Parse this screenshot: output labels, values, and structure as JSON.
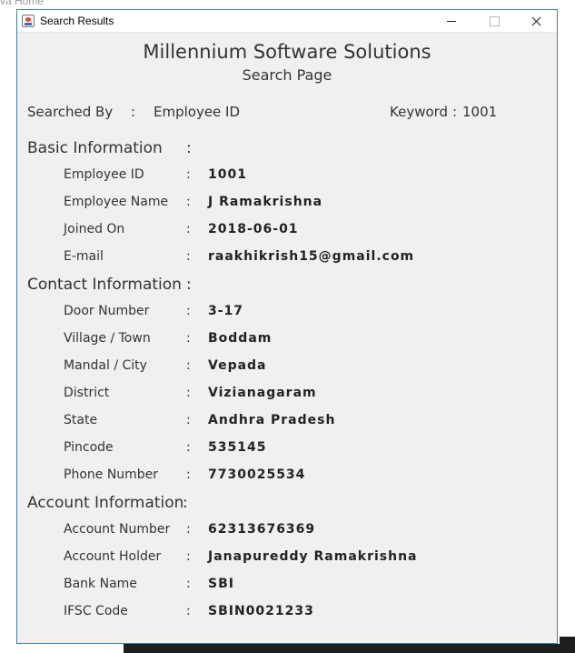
{
  "background": {
    "behind_text": "va Home"
  },
  "window": {
    "title": "Search Results"
  },
  "header": {
    "company": "Millennium Software Solutions",
    "subtitle": "Search Page"
  },
  "search": {
    "by_label": "Searched By",
    "colon": ":",
    "by_value": "Employee ID",
    "keyword_label": "Keyword",
    "keyword_colon": ":",
    "keyword_value": "1001"
  },
  "sections": {
    "basic": {
      "title": "Basic Information",
      "colon": ":",
      "fields": [
        {
          "label": "Employee  ID",
          "colon": ":",
          "value": "1001"
        },
        {
          "label": "Employee  Name",
          "colon": ":",
          "value": "J Ramakrishna"
        },
        {
          "label": "Joined  On",
          "colon": ":",
          "value": "2018-06-01"
        },
        {
          "label": "E-mail",
          "colon": ":",
          "value": "raakhikrish15@gmail.com"
        }
      ]
    },
    "contact": {
      "title": "Contact Information",
      "colon": ":",
      "fields": [
        {
          "label": "Door Number",
          "colon": ":",
          "value": "3-17"
        },
        {
          "label": "Village / Town",
          "colon": ":",
          "value": "Boddam"
        },
        {
          "label": "Mandal / City",
          "colon": ":",
          "value": "Vepada"
        },
        {
          "label": "District",
          "colon": ":",
          "value": "Vizianagaram"
        },
        {
          "label": "State",
          "colon": ":",
          "value": "Andhra Pradesh"
        },
        {
          "label": "Pincode",
          "colon": ":",
          "value": "535145"
        },
        {
          "label": "Phone Number",
          "colon": ":",
          "value": "7730025534"
        }
      ]
    },
    "account": {
      "title": "Account Information",
      "colon": ":",
      "fields": [
        {
          "label": "Account Number",
          "colon": ":",
          "value": "62313676369"
        },
        {
          "label": "Account Holder",
          "colon": ":",
          "value": "Janapureddy Ramakrishna"
        },
        {
          "label": "Bank Name",
          "colon": ":",
          "value": "SBI"
        },
        {
          "label": "IFSC Code",
          "colon": ":",
          "value": "SBIN0021233"
        }
      ]
    }
  }
}
